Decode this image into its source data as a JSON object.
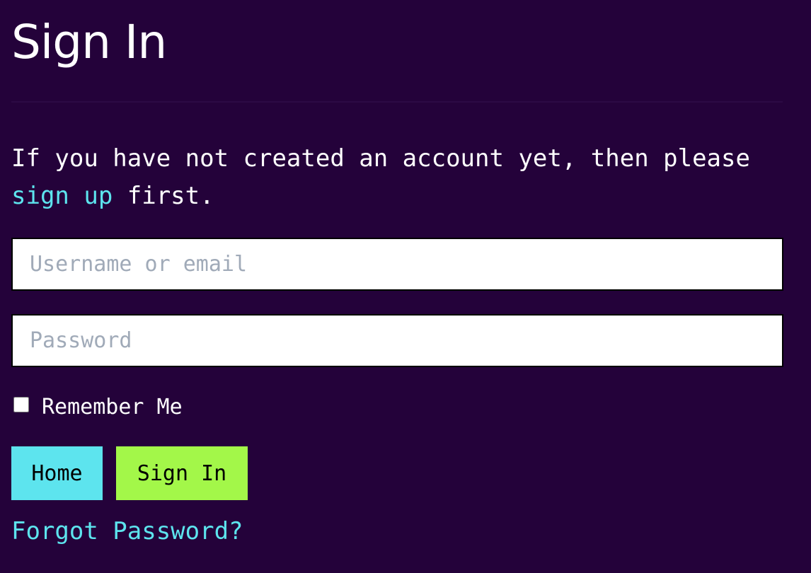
{
  "page": {
    "title": "Sign In"
  },
  "intro": {
    "text_before": "If you have not created an account yet, then please ",
    "link_label": "sign up",
    "text_after": " first."
  },
  "form": {
    "username_placeholder": "Username or email",
    "username_value": "",
    "password_placeholder": "Password",
    "password_value": "",
    "remember_label": "Remember Me",
    "remember_checked": false
  },
  "buttons": {
    "home_label": "Home",
    "signin_label": "Sign In"
  },
  "links": {
    "forgot_label": "Forgot Password?"
  },
  "colors": {
    "background": "#24023a",
    "accent_cyan": "#5de4ee",
    "accent_green": "#a3f749",
    "text": "#ffffff"
  }
}
